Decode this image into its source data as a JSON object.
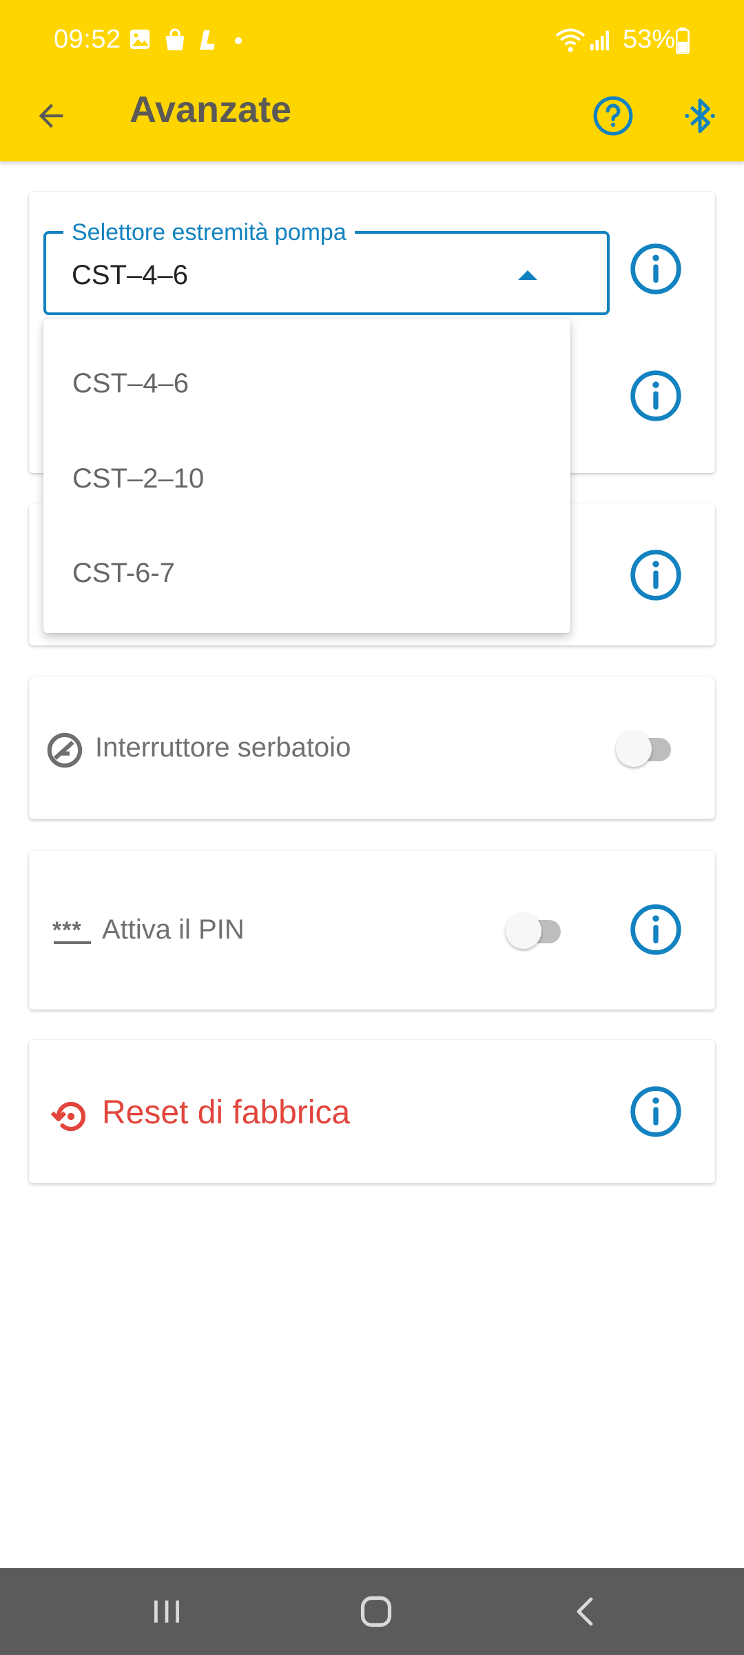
{
  "status_bar": {
    "time": "09:52",
    "battery": "53%",
    "icons": [
      "gallery-icon",
      "shopping-bag-icon",
      "l-app-icon",
      "dot-icon",
      "wifi-icon",
      "signal-icon",
      "battery-icon"
    ]
  },
  "app_bar": {
    "title": "Avanzate",
    "back_icon": "arrow-back-icon",
    "help_icon": "help-circle-icon",
    "bluetooth_icon": "bluetooth-icon"
  },
  "pump_selector": {
    "label": "Selettore estremità pompa",
    "value": "CST–4–6",
    "options": [
      "CST–4–6",
      "CST–2–10",
      "CST-6-7"
    ],
    "expanded": true
  },
  "tank_switch": {
    "label": "Interruttore serbatoio",
    "enabled": false
  },
  "pin": {
    "label": "Attiva il PIN",
    "icon_text": "***",
    "enabled": false
  },
  "factory_reset": {
    "label": "Reset di fabbrica"
  },
  "colors": {
    "app_bar": "#FFD500",
    "accent": "#1282C0",
    "danger": "#E2453C",
    "nav_bar": "#5b5b5b"
  }
}
